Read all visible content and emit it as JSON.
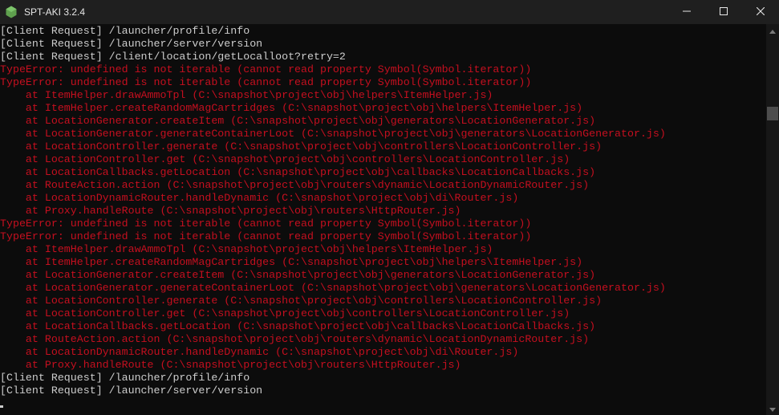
{
  "window": {
    "title": "SPT-AKI 3.2.4"
  },
  "icons": {
    "app": "node-hexagon-icon",
    "minimize": "minimize-icon",
    "maximize": "maximize-icon",
    "close": "close-icon"
  },
  "colors": {
    "background": "#0c0c0c",
    "titlebar": "#1f1f1f",
    "info_text": "#cccccc",
    "error_text": "#c50f1f",
    "app_icon": "#5fa04e"
  },
  "console": {
    "lines": [
      {
        "type": "info",
        "text": "[Client Request] /launcher/profile/info"
      },
      {
        "type": "info",
        "text": "[Client Request] /launcher/server/version"
      },
      {
        "type": "info",
        "text": "[Client Request] /client/location/getLocalloot?retry=2"
      },
      {
        "type": "error",
        "text": "TypeError: undefined is not iterable (cannot read property Symbol(Symbol.iterator))"
      },
      {
        "type": "error",
        "text": "TypeError: undefined is not iterable (cannot read property Symbol(Symbol.iterator))"
      },
      {
        "type": "error",
        "text": "    at ItemHelper.drawAmmoTpl (C:\\snapshot\\project\\obj\\helpers\\ItemHelper.js)"
      },
      {
        "type": "error",
        "text": "    at ItemHelper.createRandomMagCartridges (C:\\snapshot\\project\\obj\\helpers\\ItemHelper.js)"
      },
      {
        "type": "error",
        "text": "    at LocationGenerator.createItem (C:\\snapshot\\project\\obj\\generators\\LocationGenerator.js)"
      },
      {
        "type": "error",
        "text": "    at LocationGenerator.generateContainerLoot (C:\\snapshot\\project\\obj\\generators\\LocationGenerator.js)"
      },
      {
        "type": "error",
        "text": "    at LocationController.generate (C:\\snapshot\\project\\obj\\controllers\\LocationController.js)"
      },
      {
        "type": "error",
        "text": "    at LocationController.get (C:\\snapshot\\project\\obj\\controllers\\LocationController.js)"
      },
      {
        "type": "error",
        "text": "    at LocationCallbacks.getLocation (C:\\snapshot\\project\\obj\\callbacks\\LocationCallbacks.js)"
      },
      {
        "type": "error",
        "text": "    at RouteAction.action (C:\\snapshot\\project\\obj\\routers\\dynamic\\LocationDynamicRouter.js)"
      },
      {
        "type": "error",
        "text": "    at LocationDynamicRouter.handleDynamic (C:\\snapshot\\project\\obj\\di\\Router.js)"
      },
      {
        "type": "error",
        "text": "    at Proxy.handleRoute (C:\\snapshot\\project\\obj\\routers\\HttpRouter.js)"
      },
      {
        "type": "error",
        "text": "TypeError: undefined is not iterable (cannot read property Symbol(Symbol.iterator))"
      },
      {
        "type": "error",
        "text": "TypeError: undefined is not iterable (cannot read property Symbol(Symbol.iterator))"
      },
      {
        "type": "error",
        "text": "    at ItemHelper.drawAmmoTpl (C:\\snapshot\\project\\obj\\helpers\\ItemHelper.js)"
      },
      {
        "type": "error",
        "text": "    at ItemHelper.createRandomMagCartridges (C:\\snapshot\\project\\obj\\helpers\\ItemHelper.js)"
      },
      {
        "type": "error",
        "text": "    at LocationGenerator.createItem (C:\\snapshot\\project\\obj\\generators\\LocationGenerator.js)"
      },
      {
        "type": "error",
        "text": "    at LocationGenerator.generateContainerLoot (C:\\snapshot\\project\\obj\\generators\\LocationGenerator.js)"
      },
      {
        "type": "error",
        "text": "    at LocationController.generate (C:\\snapshot\\project\\obj\\controllers\\LocationController.js)"
      },
      {
        "type": "error",
        "text": "    at LocationController.get (C:\\snapshot\\project\\obj\\controllers\\LocationController.js)"
      },
      {
        "type": "error",
        "text": "    at LocationCallbacks.getLocation (C:\\snapshot\\project\\obj\\callbacks\\LocationCallbacks.js)"
      },
      {
        "type": "error",
        "text": "    at RouteAction.action (C:\\snapshot\\project\\obj\\routers\\dynamic\\LocationDynamicRouter.js)"
      },
      {
        "type": "error",
        "text": "    at LocationDynamicRouter.handleDynamic (C:\\snapshot\\project\\obj\\di\\Router.js)"
      },
      {
        "type": "error",
        "text": "    at Proxy.handleRoute (C:\\snapshot\\project\\obj\\routers\\HttpRouter.js)"
      },
      {
        "type": "info",
        "text": "[Client Request] /launcher/profile/info"
      },
      {
        "type": "info",
        "text": "[Client Request] /launcher/server/version"
      }
    ]
  }
}
